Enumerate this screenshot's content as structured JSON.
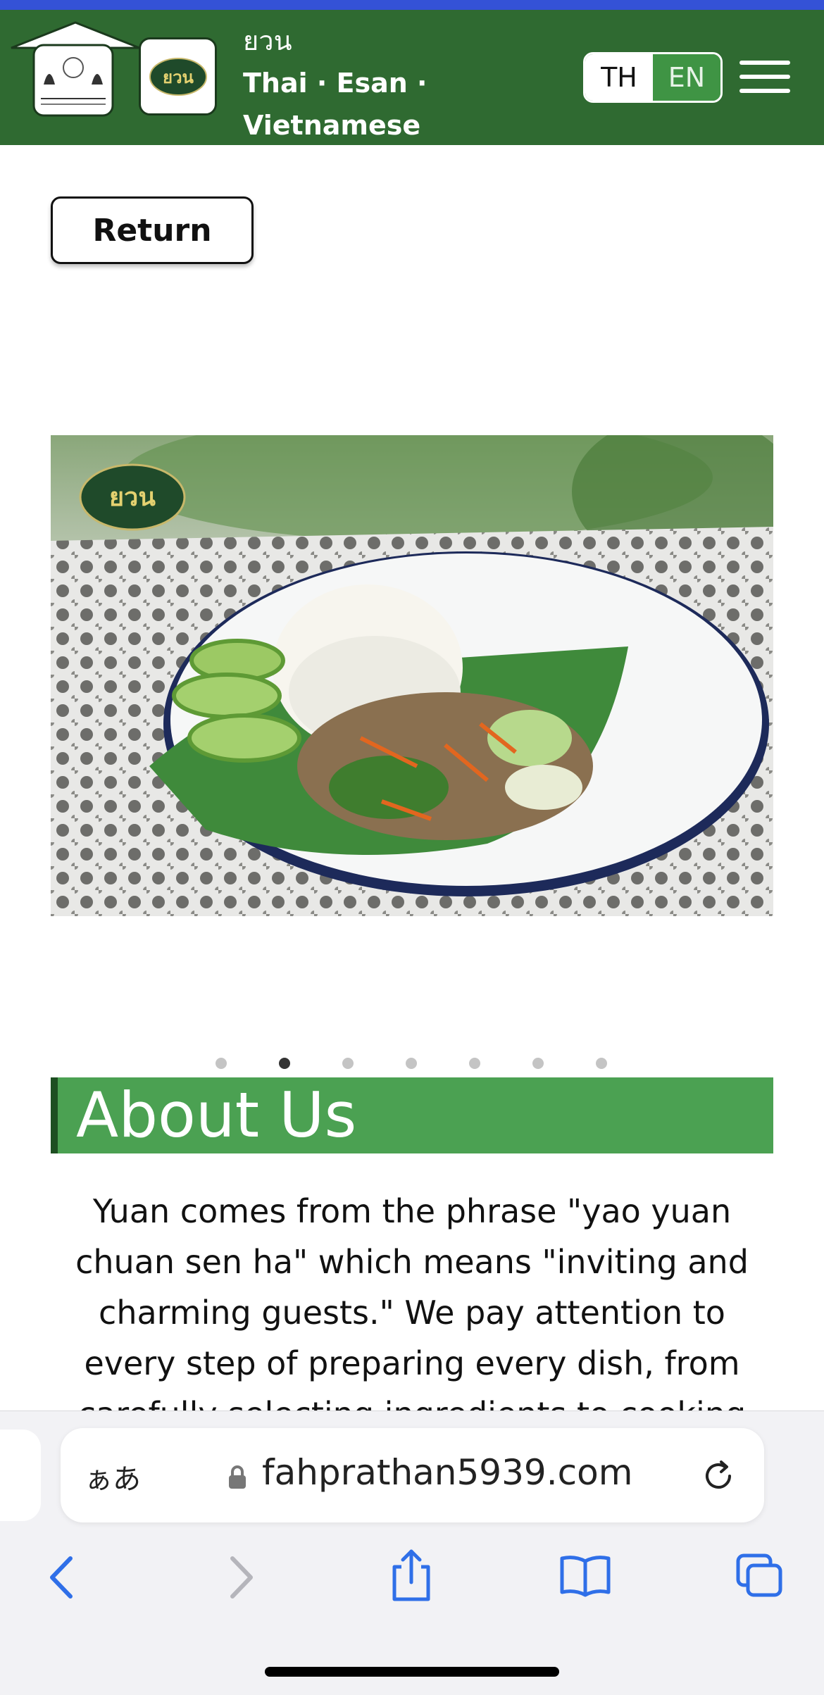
{
  "header": {
    "brand_thai": "ยวน",
    "brand_line2": "Thai · Esan ·",
    "brand_line3": "Vietnamese",
    "badge_text": "ยวน",
    "lang_th": "TH",
    "lang_en": "EN"
  },
  "return_label": "Return",
  "carousel": {
    "slide_count": 7,
    "active_index": 1,
    "logo_text": "ยวน"
  },
  "about": {
    "heading": "About Us",
    "text": "Yuan comes from the phrase \"yao yuan chuan sen ha\" which means \"inviting and charming guests.\" We pay attention to every step of preparing every dish, from carefully selecting ingredients to cooking and serving it to our"
  },
  "browser": {
    "aa_label": "ぁあ",
    "url": "fahprathan5939.com"
  },
  "colors": {
    "header_green": "#2f6a31",
    "about_green": "#4ba152",
    "accent_blue": "#3452d6"
  }
}
